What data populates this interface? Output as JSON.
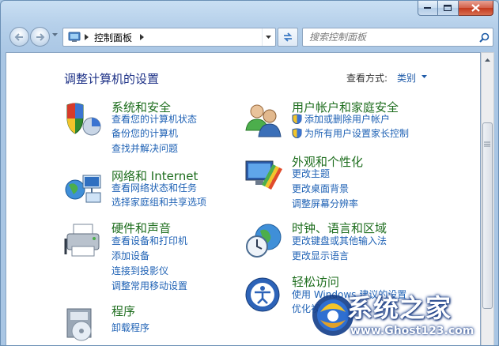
{
  "address": {
    "crumb": "控制面板"
  },
  "search": {
    "placeholder": "搜索控制面板"
  },
  "page": {
    "title": "调整计算机的设置",
    "view_by_label": "查看方式:",
    "view_by_value": "类别"
  },
  "categories": [
    {
      "title": "系统和安全",
      "icon": "shield-pie-icon",
      "links": [
        "查看您的计算机状态",
        "备份您的计算机",
        "查找并解决问题"
      ]
    },
    {
      "title": "网络和 Internet",
      "icon": "network-globe-icon",
      "links": [
        "查看网络状态和任务",
        "选择家庭组和共享选项"
      ]
    },
    {
      "title": "硬件和声音",
      "icon": "printer-icon",
      "links": [
        "查看设备和打印机",
        "添加设备",
        "连接到投影仪",
        "调整常用移动设置"
      ]
    },
    {
      "title": "程序",
      "icon": "programs-icon",
      "links": [
        "卸载程序"
      ]
    },
    {
      "title": "用户帐户和家庭安全",
      "icon": "users-icon",
      "links": [
        "添加或删除用户帐户",
        "为所有用户设置家长控制"
      ]
    },
    {
      "title": "外观和个性化",
      "icon": "monitor-palette-icon",
      "links": [
        "更改主题",
        "更改桌面背景",
        "调整屏幕分辨率"
      ]
    },
    {
      "title": "时钟、语言和区域",
      "icon": "clock-globe-icon",
      "links": [
        "更改键盘或其他输入法",
        "更改显示语言"
      ]
    },
    {
      "title": "轻松访问",
      "icon": "ease-of-access-icon",
      "links": [
        "使用 Windows 建议的设置",
        "优化视"
      ]
    }
  ],
  "watermark": {
    "title": "系统之家",
    "url": "www.Ghost123.com"
  },
  "colors": {
    "link": "#1f62b5",
    "category": "#1d6d1d",
    "title": "#1e3287"
  }
}
